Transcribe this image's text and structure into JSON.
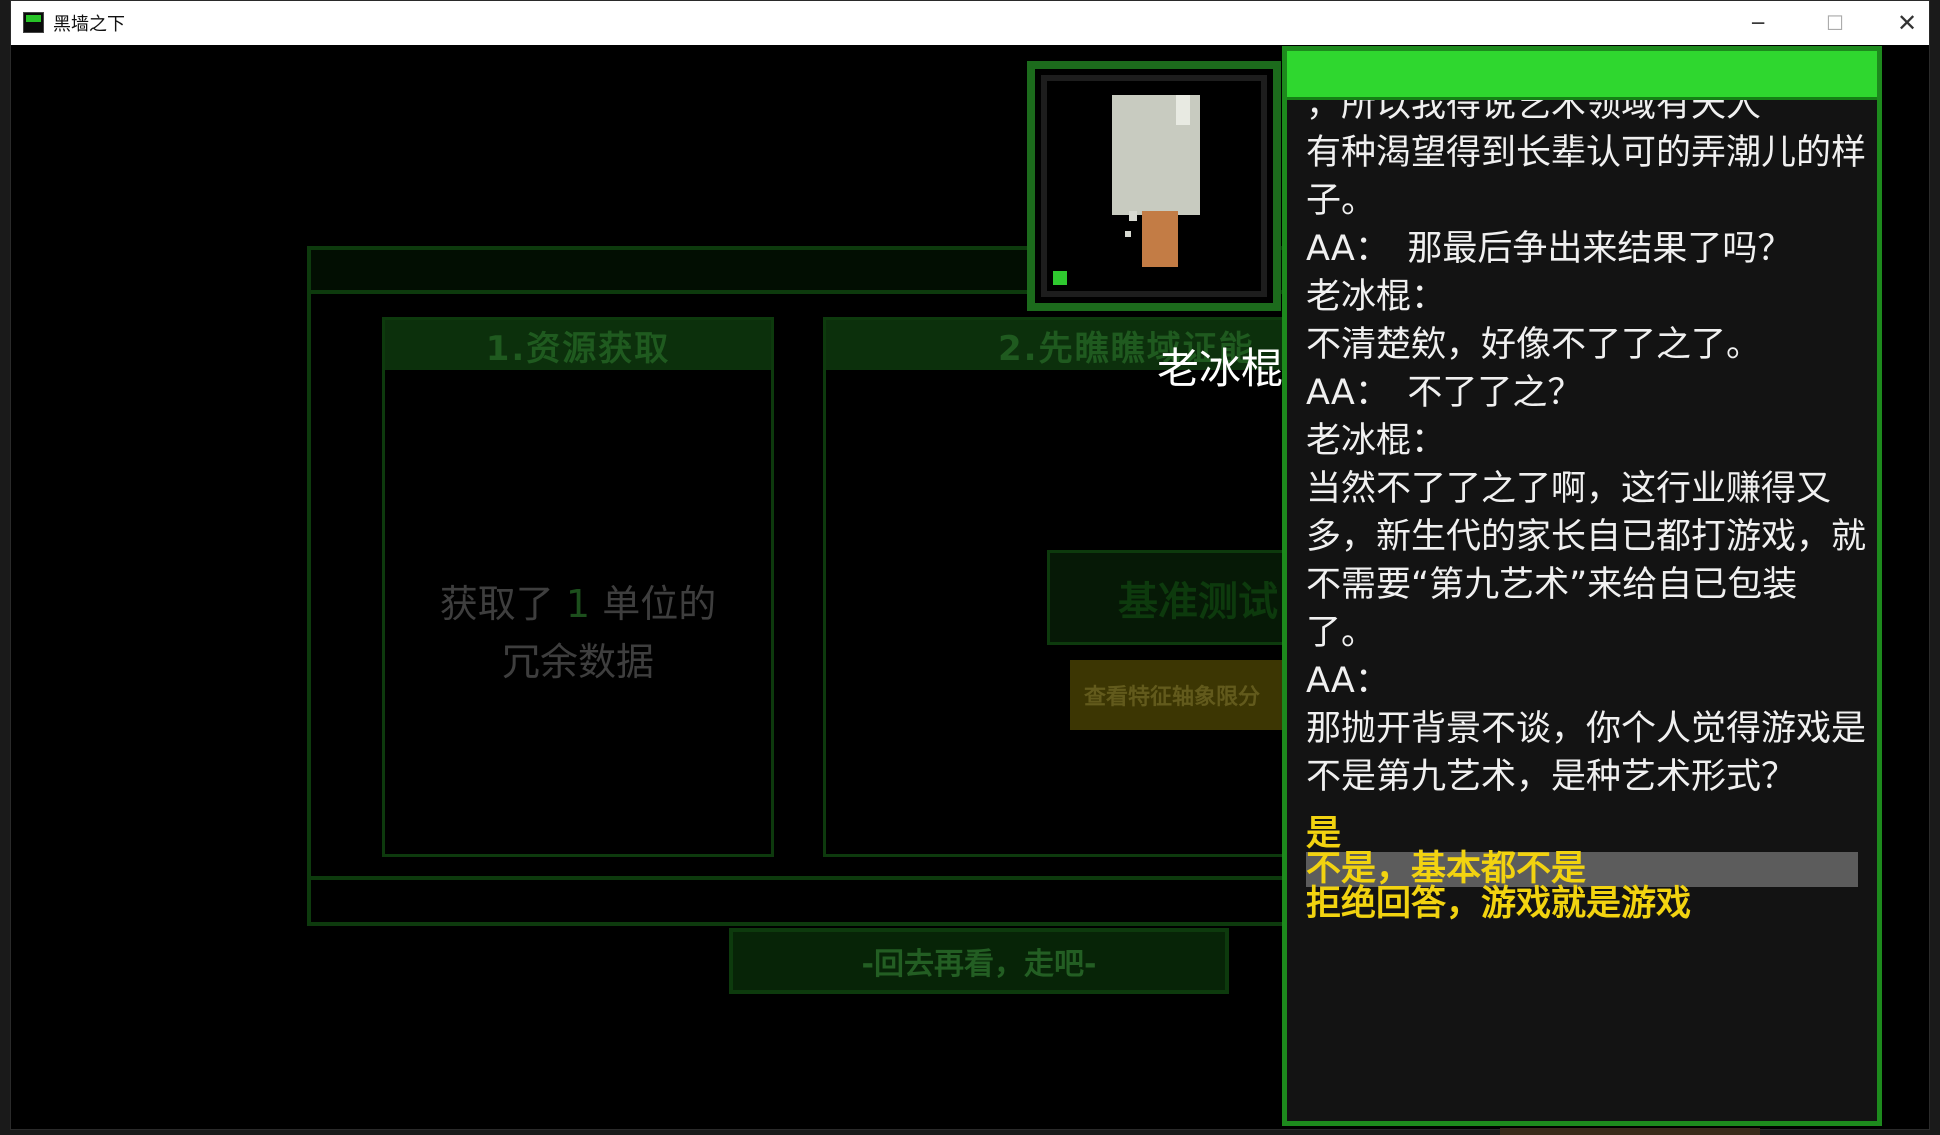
{
  "window": {
    "title": "黑墙之下",
    "minimize_glyph": "─",
    "maximize_glyph": "☐",
    "close_glyph": "✕"
  },
  "background": {
    "card1_title": "1.资源获取",
    "card2_title": "2.先瞧瞧域证能",
    "acquire_line1_a": "获取了",
    "acquire_number": "1",
    "acquire_line1_b": "单位的",
    "acquire_line2": "冗余数据",
    "test_button_label": "基准测试",
    "feature_button_label": "查看特征轴象限分",
    "back_button_label": "-回去再看，走吧-"
  },
  "character": {
    "name": "老冰棍",
    "portrait_icon": "popsicle-icon"
  },
  "dialog": {
    "lines": [
      "，所以我得说艺术领域有天人",
      "有种渴望得到长辈认可的弄潮儿的样子。",
      "AA：　那最后争出来结果了吗？",
      "老冰棍：",
      "不清楚欸，好像不了了之了。",
      "AA：　不了了之？",
      "老冰棍：",
      "当然不了了之了啊，这行业赚得又多，新生代的家长自已都打游戏，就不需要“第九艺术”来给自已包装了。",
      "AA：",
      "那抛开背景不谈，你个人觉得游戏是不是第九艺术，是种艺术形式？"
    ],
    "options": [
      "是",
      "不是，基本都不是",
      "拒绝回答，游戏就是游戏"
    ],
    "highlighted_option": 1
  },
  "colors": {
    "accent_green": "#2fd72f",
    "option_yellow": "#f2d310",
    "dialog_bg": "#131313"
  }
}
